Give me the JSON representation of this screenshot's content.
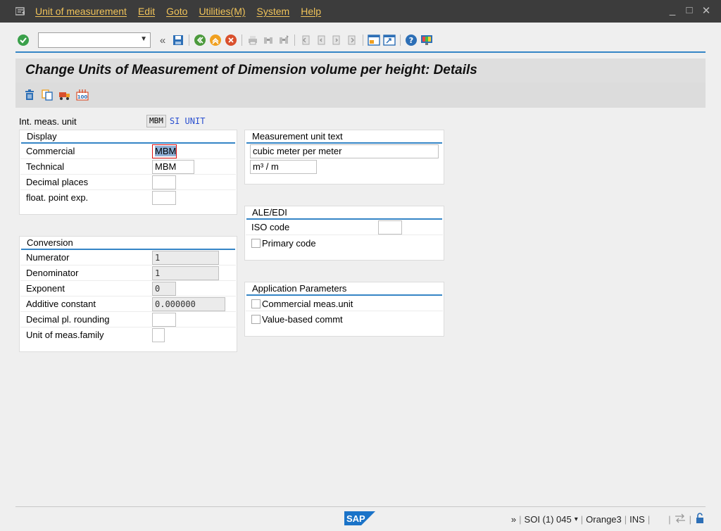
{
  "menu": {
    "items": [
      "Unit of measurement",
      "Edit",
      "Goto",
      "Utilities(M)",
      "System",
      "Help"
    ]
  },
  "window_controls": {
    "minimize": "_",
    "maximize": "□",
    "close": "✕"
  },
  "toolbar": {
    "command_value": ""
  },
  "title": "Change Units of Measurement of Dimension volume per height: Details",
  "int_meas": {
    "label": "Int. meas. unit",
    "value": "MBM",
    "si": "SI UNIT"
  },
  "display": {
    "header": "Display",
    "commercial_label": "Commercial",
    "commercial_value": "MBM",
    "technical_label": "Technical",
    "technical_value": "MBM",
    "decimal_label": "Decimal places",
    "decimal_value": "",
    "float_label": "float. point exp.",
    "float_value": ""
  },
  "conversion": {
    "header": "Conversion",
    "numerator_label": "Numerator",
    "numerator_value": "1",
    "denominator_label": "Denominator",
    "denominator_value": "1",
    "exponent_label": "Exponent",
    "exponent_value": "0",
    "additive_label": "Additive constant",
    "additive_value": "0.000000",
    "rounding_label": "Decimal pl. rounding",
    "rounding_value": "",
    "family_label": "Unit of meas.family",
    "family_value": ""
  },
  "mut": {
    "header": "Measurement unit text",
    "long_text": "cubic meter per meter",
    "short_text": "m³ / m"
  },
  "ale": {
    "header": "ALE/EDI",
    "iso_label": "ISO code",
    "iso_value": "",
    "primary_label": "Primary code"
  },
  "app_params": {
    "header": "Application Parameters",
    "commercial_label": "Commercial meas.unit",
    "value_label": "Value-based commt"
  },
  "status": {
    "arrows": "»",
    "system": "SOI (1) 045",
    "server": "Orange3",
    "mode": "INS",
    "logo": "SAP"
  },
  "colors": {
    "accent": "#3585c6",
    "menu_bg": "#3c3c3c",
    "menu_text": "#f0c35a"
  }
}
